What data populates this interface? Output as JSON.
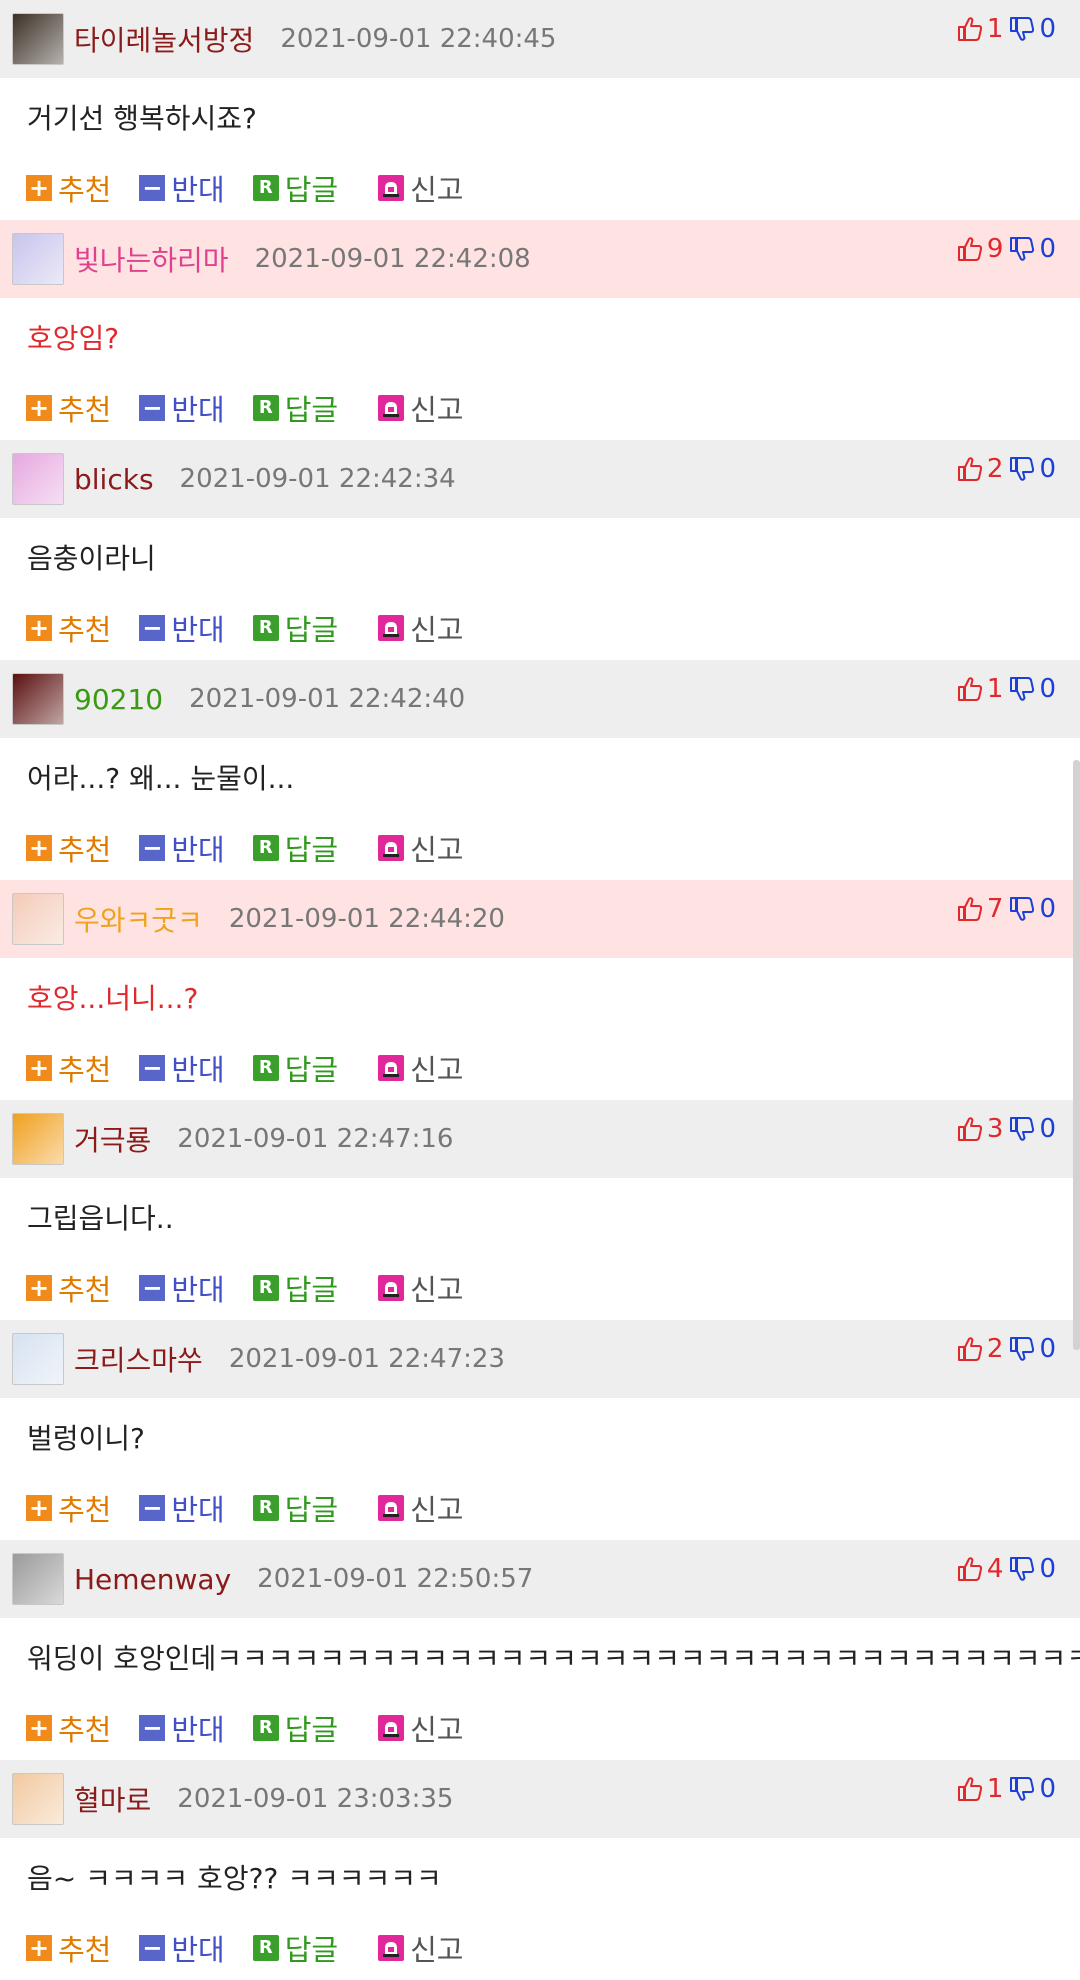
{
  "actions": {
    "recommend": "추천",
    "oppose": "반대",
    "reply": "답글",
    "report": "신고"
  },
  "colors": {
    "best_header": "#ffe3e3",
    "normal_header": "#eeeeee",
    "nick_default": "#8b1a1a",
    "nick_pink": "#e0418f",
    "nick_green": "#3a9a12",
    "nick_orange": "#f0a21a",
    "upvote": "#e0282d",
    "downvote": "#1c3fd6"
  },
  "comments": [
    {
      "nickname": "타이레놀서방정",
      "time": "2021-09-01 22:40:45",
      "up": "1",
      "down": "0",
      "text": "거기선 행복하시죠?",
      "best": false,
      "nick_color": "#8b1a1a",
      "avatar_icon": "face-avatar-icon",
      "avatar_color": "#3b3026"
    },
    {
      "nickname": "빛나는하리마",
      "time": "2021-09-01 22:42:08",
      "up": "9",
      "down": "0",
      "text": "호앙임?",
      "best": true,
      "nick_color": "#e0418f",
      "avatar_icon": "anime-avatar-icon",
      "avatar_color": "#c9c4ec"
    },
    {
      "nickname": "blicks",
      "time": "2021-09-01 22:42:34",
      "up": "2",
      "down": "0",
      "text": "음충이라니",
      "best": false,
      "nick_color": "#8b1a1a",
      "avatar_icon": "pink-creature-avatar-icon",
      "avatar_color": "#e6a8e0"
    },
    {
      "nickname": "90210",
      "time": "2021-09-01 22:42:40",
      "up": "1",
      "down": "0",
      "text": "어라...? 왜... 눈물이...",
      "best": false,
      "nick_color": "#3a9a12",
      "avatar_icon": "hell-avatar-icon",
      "avatar_color": "#5a1010"
    },
    {
      "nickname": "우와ㅋ굿ㅋ",
      "time": "2021-09-01 22:44:20",
      "up": "7",
      "down": "0",
      "text": "호앙...너니...?",
      "best": true,
      "nick_color": "#f0a21a",
      "avatar_icon": "girl-avatar-icon",
      "avatar_color": "#f3cbb8"
    },
    {
      "nickname": "거극룡",
      "time": "2021-09-01 22:47:16",
      "up": "3",
      "down": "0",
      "text": "그립읍니다..",
      "best": false,
      "nick_color": "#8b1a1a",
      "avatar_icon": "lion-avatar-icon",
      "avatar_color": "#f0a020"
    },
    {
      "nickname": "크리스마쑤",
      "time": "2021-09-01 22:47:23",
      "up": "2",
      "down": "0",
      "text": "벌렁이니?",
      "best": false,
      "nick_color": "#8b1a1a",
      "avatar_icon": "tree-avatar-icon",
      "avatar_color": "#d6e2f0"
    },
    {
      "nickname": "Hemenway",
      "time": "2021-09-01 22:50:57",
      "up": "4",
      "down": "0",
      "text": "워딩이 호앙인데ㅋㅋㅋㅋㅋㅋㅋㅋㅋㅋㅋㅋㅋㅋㅋㅋㅋㅋㅋㅋㅋㅋㅋㅋㅋㅋㅋㅋㅋㅋㅋㅋㅋㅋㅋ",
      "best": false,
      "nick_color": "#8b1a1a",
      "avatar_icon": "v-avatar-icon",
      "avatar_color": "#9a9a9a"
    },
    {
      "nickname": "혈마로",
      "time": "2021-09-01 23:03:35",
      "up": "1",
      "down": "0",
      "text": "음~ ㅋㅋㅋㅋ 호앙?? ㅋㅋㅋㅋㅋㅋ",
      "best": false,
      "nick_color": "#8b1a1a",
      "avatar_icon": "pixel-man-avatar-icon",
      "avatar_color": "#f2c9a0"
    }
  ]
}
